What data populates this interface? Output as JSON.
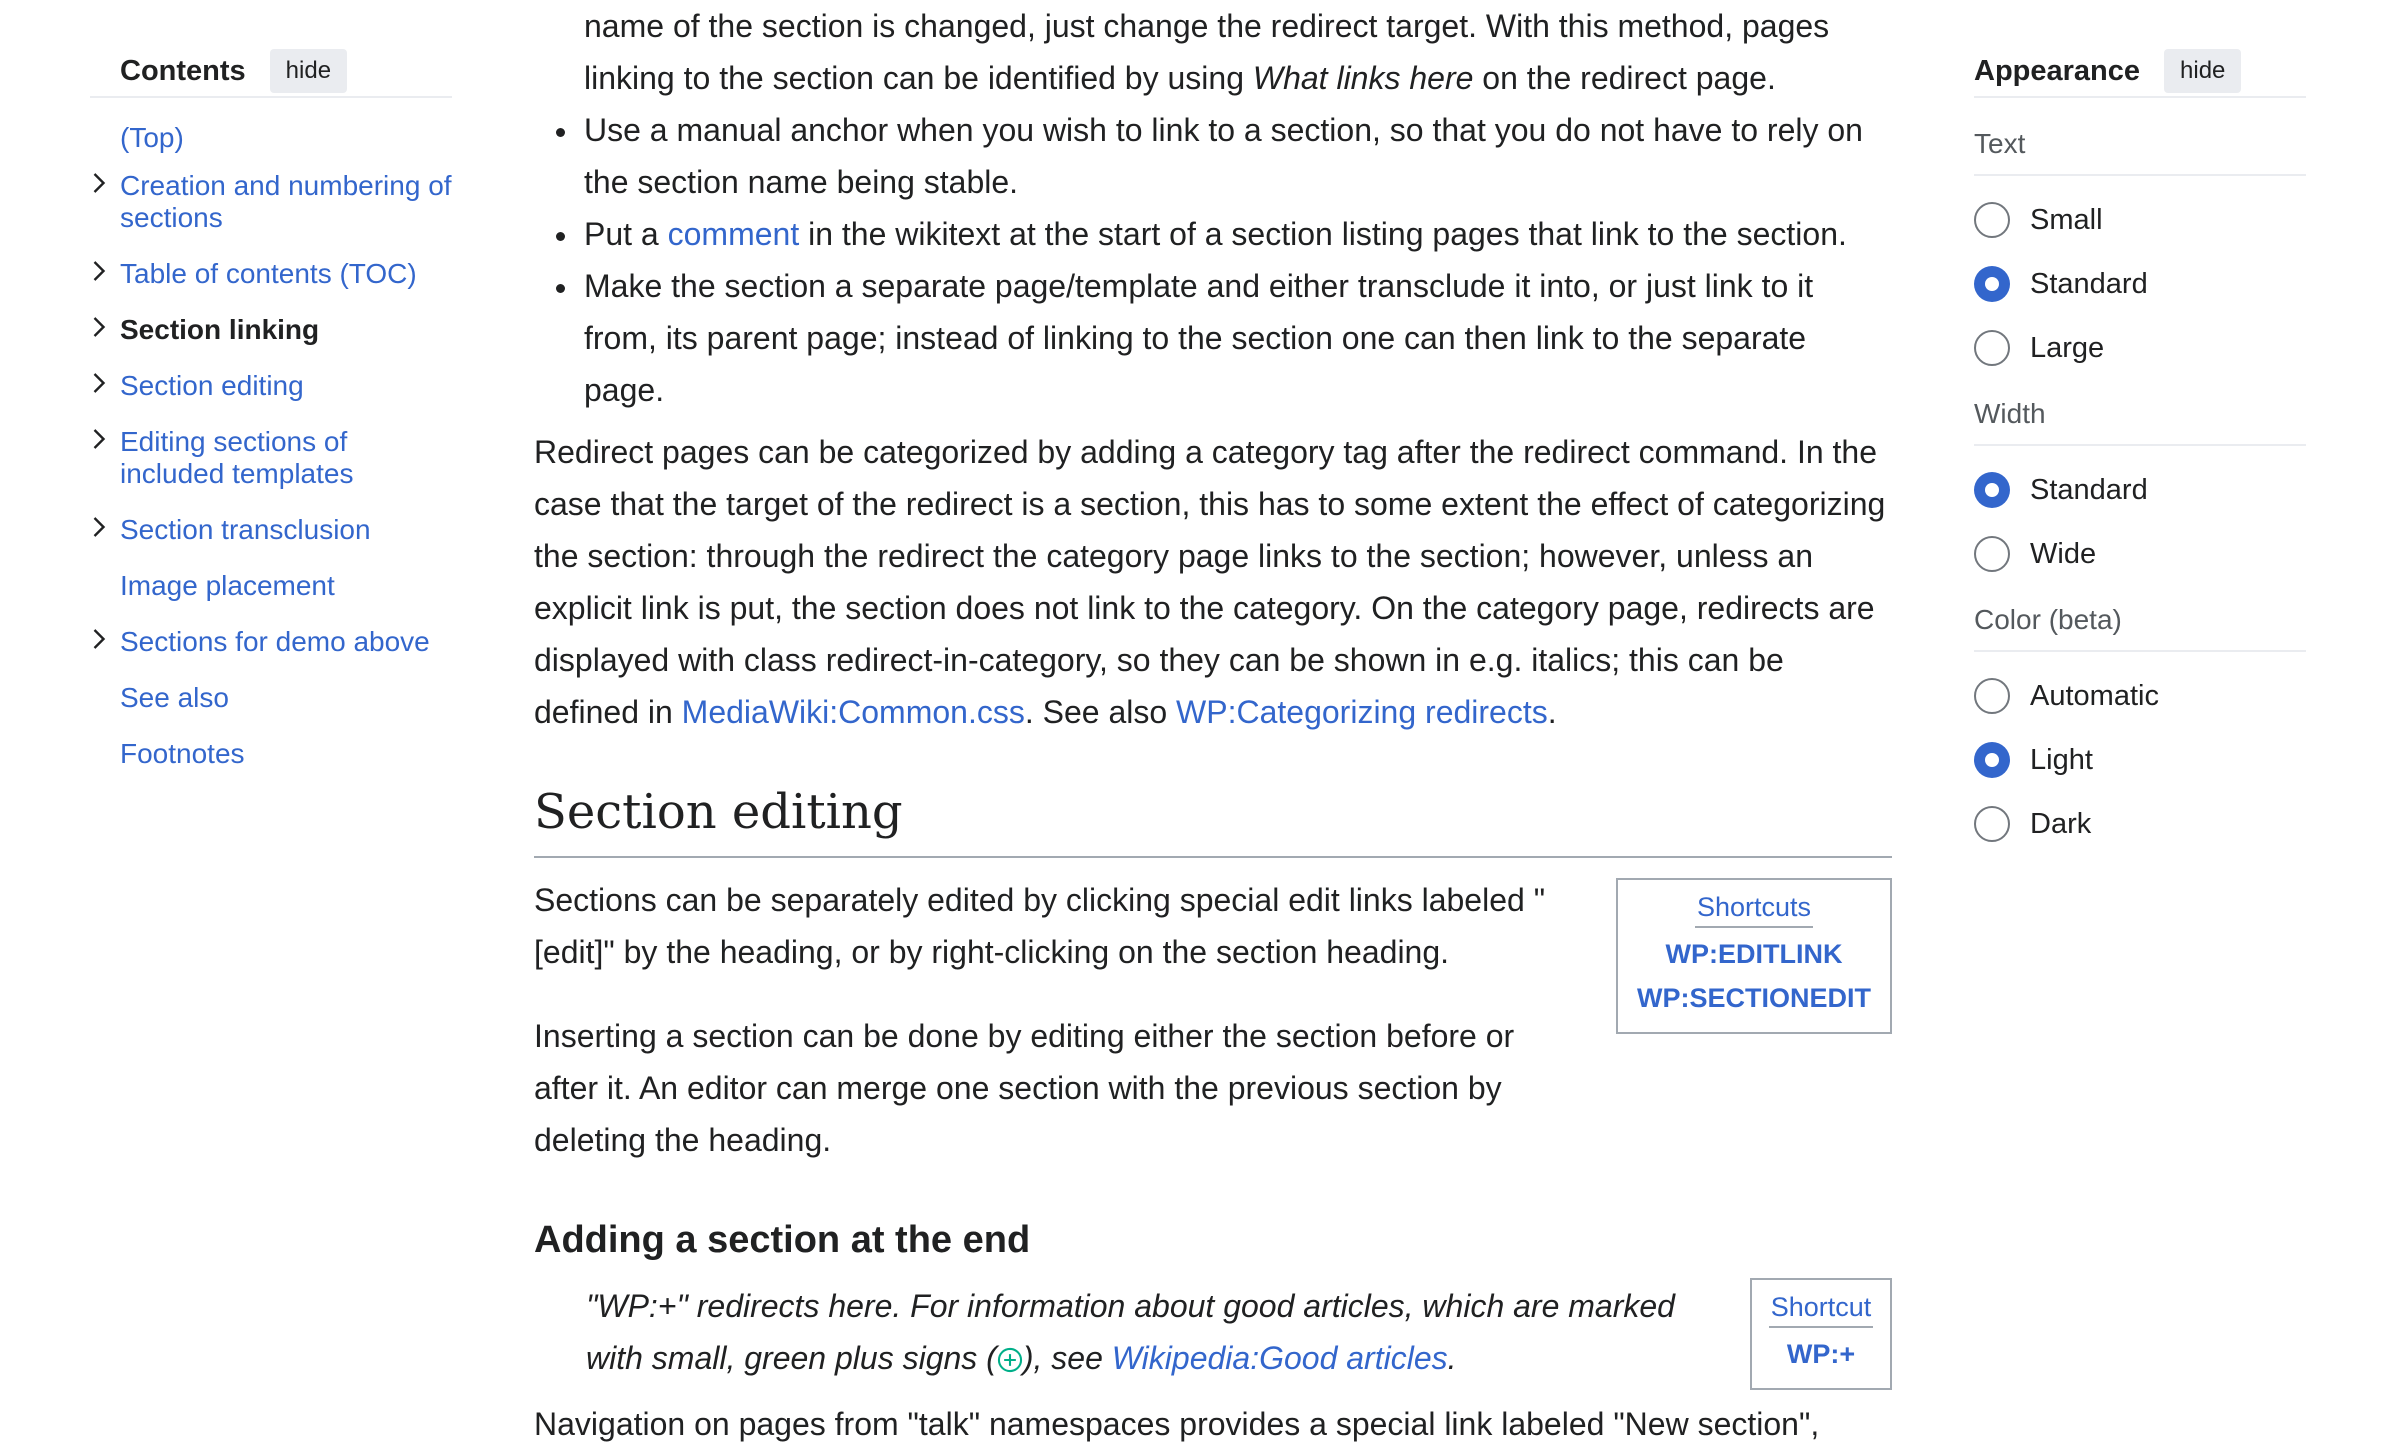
{
  "toc": {
    "title": "Contents",
    "hide_label": "hide",
    "items": [
      {
        "label": "(Top)",
        "chevron": false,
        "active": false
      },
      {
        "label": "Creation and numbering of sections",
        "chevron": true,
        "active": false
      },
      {
        "label": "Table of contents (TOC)",
        "chevron": true,
        "active": false
      },
      {
        "label": "Section linking",
        "chevron": true,
        "active": true
      },
      {
        "label": "Section editing",
        "chevron": true,
        "active": false
      },
      {
        "label": "Editing sections of included templates",
        "chevron": true,
        "active": false
      },
      {
        "label": "Section transclusion",
        "chevron": true,
        "active": false
      },
      {
        "label": "Image placement",
        "chevron": false,
        "active": false
      },
      {
        "label": "Sections for demo above",
        "chevron": true,
        "active": false
      },
      {
        "label": "See also",
        "chevron": false,
        "active": false
      },
      {
        "label": "Footnotes",
        "chevron": false,
        "active": false
      }
    ]
  },
  "article": {
    "cont_line1": "name of the section is changed, just change the redirect target. With this method, pages",
    "cont_line2_pre": "linking to the section can be identified by using ",
    "cont_line2_em": "What links here",
    "cont_line2_post": " on the redirect page.",
    "bullet1": "Use a manual anchor when you wish to link to a section, so that you do not have to rely on the section name being stable.",
    "bullet2_pre": "Put a ",
    "bullet2_link": "comment",
    "bullet2_post": " in the wikitext at the start of a section listing pages that link to the section.",
    "bullet3": "Make the section a separate page/template and either transclude it into, or just link to it from, its parent page; instead of linking to the section one can then link to the separate page.",
    "redirect_para": "Redirect pages can be categorized by adding a category tag after the redirect command. In the case that the target of the redirect is a section, this has to some extent the effect of categorizing the section: through the redirect the category page links to the section; however, unless an explicit link is put, the section does not link to the category. On the category page, redirects are displayed with class redirect-in-category, so they can be shown in e.g. italics; this can be defined in ",
    "redirect_link1": "MediaWiki:Common.css",
    "redirect_mid": ". See also ",
    "redirect_link2": "WP:Categorizing redirects",
    "redirect_end": ".",
    "h2_section_editing": "Section editing",
    "se_para1": "Sections can be separately edited by clicking special edit links labeled \"[edit]\" by the heading, or by right-clicking on the section heading.",
    "se_para2": "Inserting a section can be done by editing either the section before or after it. An editor can merge one section with the previous section by deleting the heading.",
    "shortcuts_box": {
      "title": "Shortcuts",
      "links": [
        "WP:EDITLINK",
        "WP:SECTIONEDIT"
      ]
    },
    "h3_adding": "Adding a section at the end",
    "hatnote_pre": "\"WP:+\" redirects here. For information about good articles, which are marked with small, green plus signs (",
    "hatnote_mid": "), see ",
    "hatnote_link": "Wikipedia:Good articles",
    "hatnote_end": ".",
    "shortcut_box2": {
      "title": "Shortcut",
      "links": [
        "WP:+"
      ]
    },
    "last_line": "Navigation on pages from \"talk\" namespaces provides a special link labeled \"New section\","
  },
  "appearance": {
    "title": "Appearance",
    "hide_label": "hide",
    "sections": [
      {
        "title": "Text",
        "options": [
          {
            "label": "Small",
            "selected": false
          },
          {
            "label": "Standard",
            "selected": true
          },
          {
            "label": "Large",
            "selected": false
          }
        ]
      },
      {
        "title": "Width",
        "options": [
          {
            "label": "Standard",
            "selected": true
          },
          {
            "label": "Wide",
            "selected": false
          }
        ]
      },
      {
        "title": "Color (beta)",
        "options": [
          {
            "label": "Automatic",
            "selected": false
          },
          {
            "label": "Light",
            "selected": true
          },
          {
            "label": "Dark",
            "selected": false
          }
        ]
      }
    ]
  },
  "colors": {
    "link": "#3366cc",
    "text": "#202122",
    "accent": "#3366cc",
    "plus_icon": "#00af89"
  },
  "icons": {
    "chevron": "chevron-right-icon",
    "plus": "plus-circle-icon"
  }
}
